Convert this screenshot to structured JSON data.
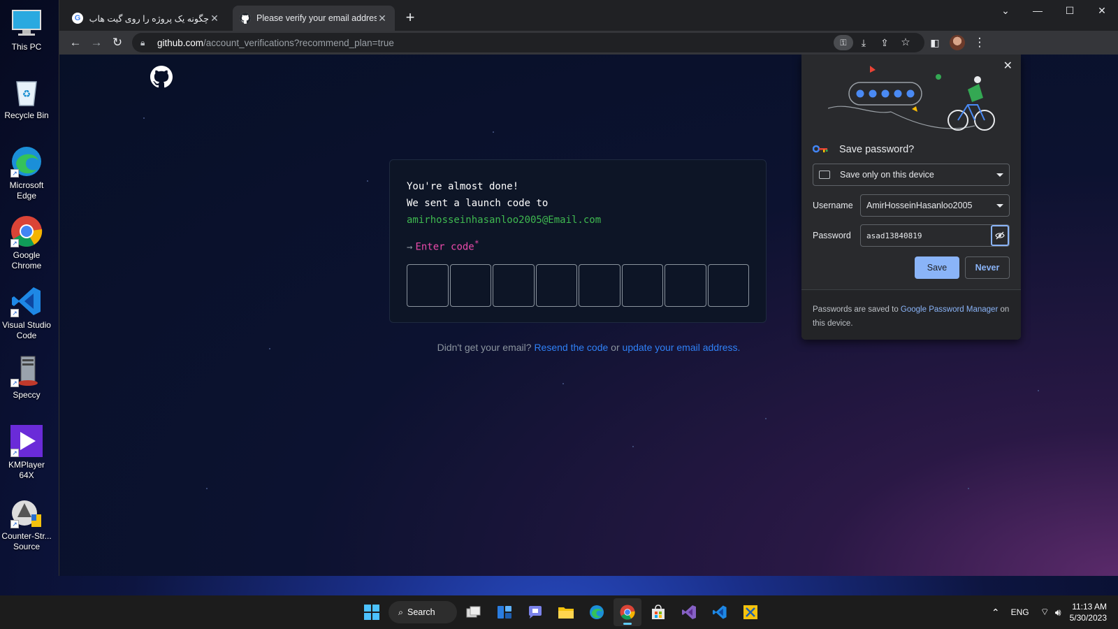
{
  "desktop": {
    "icons": [
      {
        "label": "This PC"
      },
      {
        "label": "Recycle Bin"
      },
      {
        "label": "Microsoft Edge"
      },
      {
        "label": "Google Chrome"
      },
      {
        "label": "Visual Studio Code"
      },
      {
        "label": "Speccy"
      },
      {
        "label": "KMPlayer 64X"
      },
      {
        "label": "Counter-Str... Source"
      }
    ]
  },
  "browser": {
    "tabs": [
      {
        "title": "چگونه یک پروژه را روی گیت هاب بگ",
        "icon": "google-icon",
        "active": false
      },
      {
        "title": "Please verify your email address",
        "icon": "github-icon",
        "active": true
      }
    ],
    "url": {
      "host": "github.com",
      "path": "/account_verifications?recommend_plan=true"
    }
  },
  "page": {
    "line1": "You're almost done!",
    "line2": "We sent a launch code to",
    "email": "amirhosseinhasanloo2005@Email.com",
    "prompt": "Enter code",
    "prompt_required": "*",
    "code_boxes": 8,
    "resend_prefix": "Didn't get your email? ",
    "resend_link": "Resend the code",
    "resend_middle": " or ",
    "update_link": "update your email address.",
    "colors": {
      "email": "#3fb950",
      "prompt": "#ea4aaa",
      "link": "#2f81f7"
    }
  },
  "password_popup": {
    "title": "Save password?",
    "device_option": "Save only on this device",
    "username_label": "Username",
    "username": "AmirHosseinHasanloo2005",
    "password_label": "Password",
    "password": "asad13840819",
    "save_label": "Save",
    "never_label": "Never",
    "footer_prefix": "Passwords are saved to ",
    "footer_link": "Google Password Manager",
    "footer_suffix": " on this device."
  },
  "taskbar": {
    "search_label": "Search",
    "lang": "ENG",
    "time": "11:13 AM",
    "date": "5/30/2023"
  }
}
